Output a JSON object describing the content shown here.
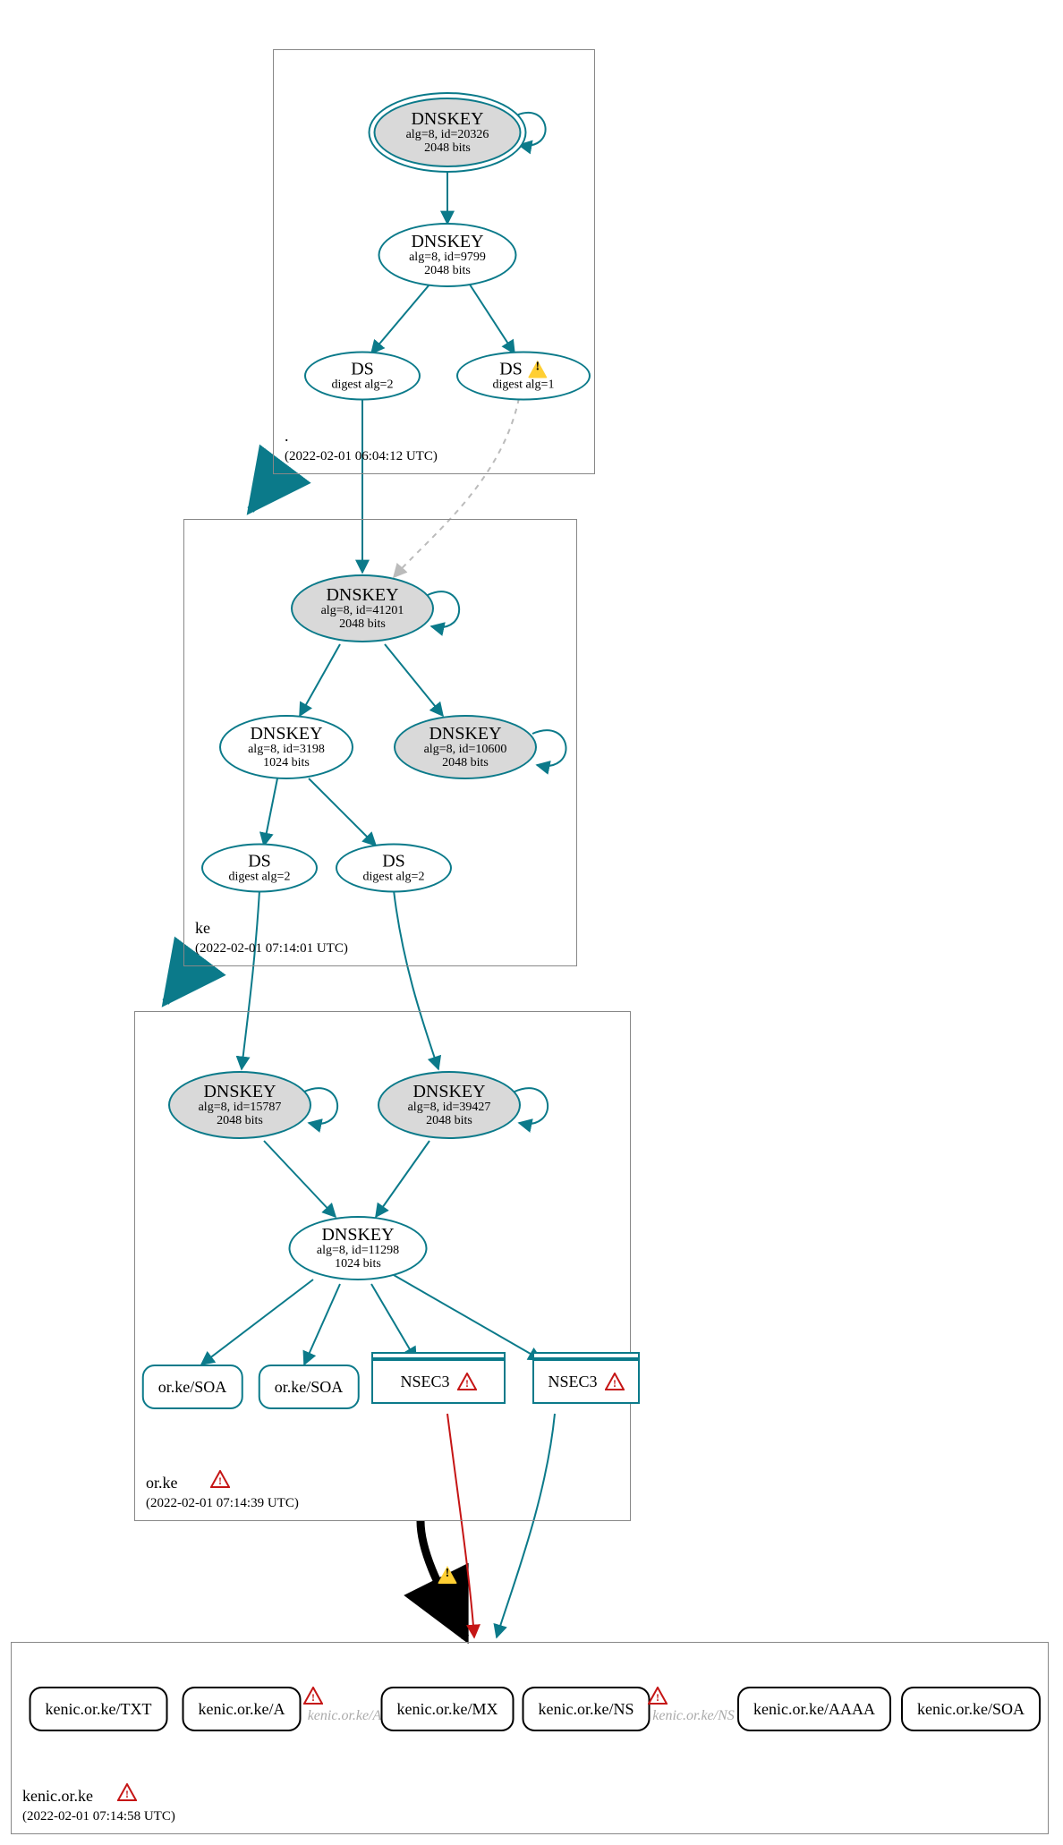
{
  "colors": {
    "stroke": "#0b7a8a",
    "grey": "#d9d9d9",
    "error": "#c51515",
    "warn": "#ffcf33"
  },
  "zones": {
    "root": {
      "name": ".",
      "timestamp": "(2022-02-01 06:04:12 UTC)",
      "has_error": false
    },
    "ke": {
      "name": "ke",
      "timestamp": "(2022-02-01 07:14:01 UTC)",
      "has_error": false
    },
    "orke": {
      "name": "or.ke",
      "timestamp": "(2022-02-01 07:14:39 UTC)",
      "has_error": true
    },
    "kenic": {
      "name": "kenic.or.ke",
      "timestamp": "(2022-02-01 07:14:58 UTC)",
      "has_error": true
    }
  },
  "nodes": {
    "root_ksk": {
      "title": "DNSKEY",
      "line2": "alg=8, id=20326",
      "line3": "2048 bits"
    },
    "root_zsk": {
      "title": "DNSKEY",
      "line2": "alg=8, id=9799",
      "line3": "2048 bits"
    },
    "ds_root_1": {
      "title": "DS",
      "line2": "digest alg=2"
    },
    "ds_root_2": {
      "title": "DS",
      "line2": "digest alg=1",
      "warn": true
    },
    "ke_ksk": {
      "title": "DNSKEY",
      "line2": "alg=8, id=41201",
      "line3": "2048 bits"
    },
    "ke_zsk": {
      "title": "DNSKEY",
      "line2": "alg=8, id=3198",
      "line3": "1024 bits"
    },
    "ke_key2": {
      "title": "DNSKEY",
      "line2": "alg=8, id=10600",
      "line3": "2048 bits"
    },
    "ds_ke_1": {
      "title": "DS",
      "line2": "digest alg=2"
    },
    "ds_ke_2": {
      "title": "DS",
      "line2": "digest alg=2"
    },
    "orke_ksk1": {
      "title": "DNSKEY",
      "line2": "alg=8, id=15787",
      "line3": "2048 bits"
    },
    "orke_ksk2": {
      "title": "DNSKEY",
      "line2": "alg=8, id=39427",
      "line3": "2048 bits"
    },
    "orke_zsk": {
      "title": "DNSKEY",
      "line2": "alg=8, id=11298",
      "line3": "1024 bits"
    }
  },
  "records": {
    "soa1": "or.ke/SOA",
    "soa2": "or.ke/SOA",
    "nsec3": "NSEC3",
    "kenic_txt": "kenic.or.ke/TXT",
    "kenic_a": "kenic.or.ke/A",
    "kenic_mx": "kenic.or.ke/MX",
    "kenic_ns": "kenic.or.ke/NS",
    "kenic_aaaa": "kenic.or.ke/AAAA",
    "kenic_soa": "kenic.or.ke/SOA",
    "ghost_a": "kenic.or.ke/A",
    "ghost_ns": "kenic.or.ke/NS"
  }
}
